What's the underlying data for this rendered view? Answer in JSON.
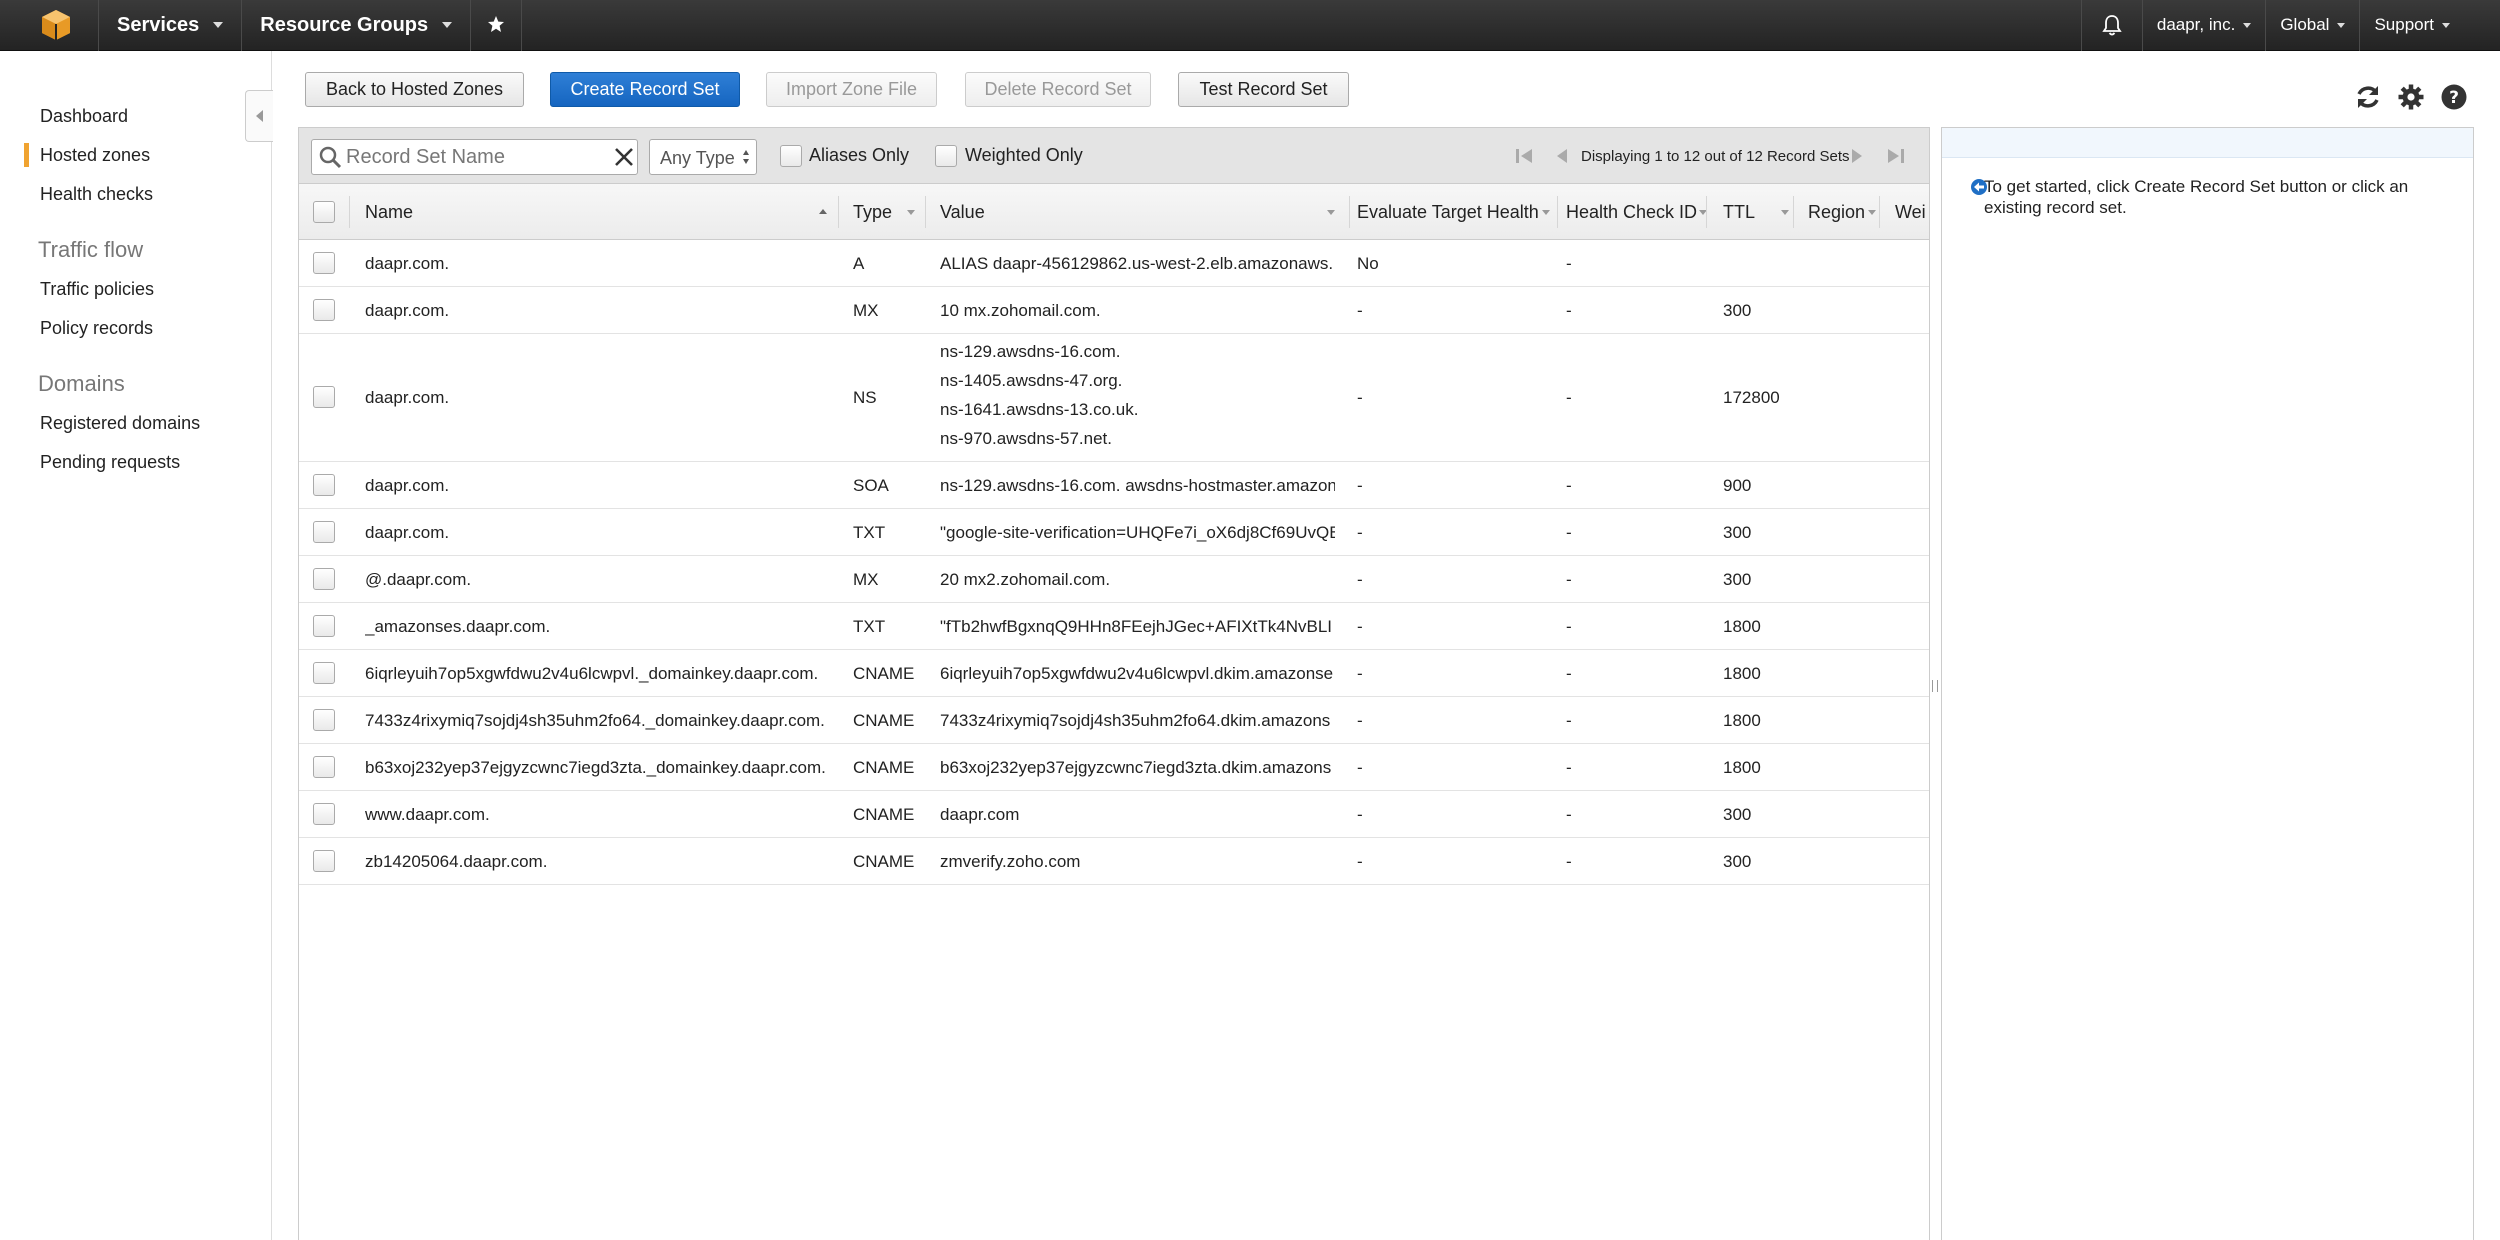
{
  "nav": {
    "services": "Services",
    "resource_groups": "Resource Groups",
    "account": "daapr, inc.",
    "region": "Global",
    "support": "Support"
  },
  "sidebar": {
    "items": [
      {
        "label": "Dashboard"
      },
      {
        "label": "Hosted zones"
      },
      {
        "label": "Health checks"
      }
    ],
    "traffic_heading": "Traffic flow",
    "traffic_items": [
      {
        "label": "Traffic policies"
      },
      {
        "label": "Policy records"
      }
    ],
    "domains_heading": "Domains",
    "domain_items": [
      {
        "label": "Registered domains"
      },
      {
        "label": "Pending requests"
      }
    ]
  },
  "toolbar": {
    "back": "Back to Hosted Zones",
    "create": "Create Record Set",
    "import": "Import Zone File",
    "delete": "Delete Record Set",
    "test": "Test Record Set"
  },
  "filter": {
    "search_placeholder": "Record Set Name",
    "type_select": "Any Type",
    "aliases_only": "Aliases Only",
    "weighted_only": "Weighted Only",
    "pager": "Displaying 1 to 12 out of 12 Record Sets"
  },
  "table": {
    "columns": [
      "Name",
      "Type",
      "Value",
      "Evaluate Target Health",
      "Health Check ID",
      "TTL",
      "Region",
      "Wei"
    ],
    "rows": [
      {
        "name": "daapr.com.",
        "type": "A",
        "value": [
          "ALIAS daapr-456129862.us-west-2.elb.amazonaws."
        ],
        "eth": "No",
        "hc": "-",
        "ttl": ""
      },
      {
        "name": "daapr.com.",
        "type": "MX",
        "value": [
          "10 mx.zohomail.com."
        ],
        "eth": "-",
        "hc": "-",
        "ttl": "300"
      },
      {
        "name": "daapr.com.",
        "type": "NS",
        "value": [
          "ns-129.awsdns-16.com.",
          "ns-1405.awsdns-47.org.",
          "ns-1641.awsdns-13.co.uk.",
          "ns-970.awsdns-57.net."
        ],
        "eth": "-",
        "hc": "-",
        "ttl": "172800"
      },
      {
        "name": "daapr.com.",
        "type": "SOA",
        "value": [
          "ns-129.awsdns-16.com. awsdns-hostmaster.amazon"
        ],
        "eth": "-",
        "hc": "-",
        "ttl": "900"
      },
      {
        "name": "daapr.com.",
        "type": "TXT",
        "value": [
          "\"google-site-verification=UHQFe7i_oX6dj8Cf69UvQB"
        ],
        "eth": "-",
        "hc": "-",
        "ttl": "300"
      },
      {
        "name": "@.daapr.com.",
        "type": "MX",
        "value": [
          "20 mx2.zohomail.com."
        ],
        "eth": "-",
        "hc": "-",
        "ttl": "300"
      },
      {
        "name": "_amazonses.daapr.com.",
        "type": "TXT",
        "value": [
          "\"fTb2hwfBgxnqQ9HHn8FEejhJGec+AFIXtTk4NvBLI"
        ],
        "eth": "-",
        "hc": "-",
        "ttl": "1800"
      },
      {
        "name": "6iqrleyuih7op5xgwfdwu2v4u6lcwpvl._domainkey.daapr.com.",
        "type": "CNAME",
        "value": [
          "6iqrleyuih7op5xgwfdwu2v4u6lcwpvl.dkim.amazonse"
        ],
        "eth": "-",
        "hc": "-",
        "ttl": "1800"
      },
      {
        "name": "7433z4rixymiq7sojdj4sh35uhm2fo64._domainkey.daapr.com.",
        "type": "CNAME",
        "value": [
          "7433z4rixymiq7sojdj4sh35uhm2fo64.dkim.amazons"
        ],
        "eth": "-",
        "hc": "-",
        "ttl": "1800"
      },
      {
        "name": "b63xoj232yep37ejgyzcwnc7iegd3zta._domainkey.daapr.com.",
        "type": "CNAME",
        "value": [
          "b63xoj232yep37ejgyzcwnc7iegd3zta.dkim.amazons"
        ],
        "eth": "-",
        "hc": "-",
        "ttl": "1800"
      },
      {
        "name": "www.daapr.com.",
        "type": "CNAME",
        "value": [
          "daapr.com"
        ],
        "eth": "-",
        "hc": "-",
        "ttl": "300"
      },
      {
        "name": "zb14205064.daapr.com.",
        "type": "CNAME",
        "value": [
          "zmverify.zoho.com"
        ],
        "eth": "-",
        "hc": "-",
        "ttl": "300"
      }
    ]
  },
  "info": {
    "text": "To get started, click Create Record Set button or click an existing record set."
  },
  "colors": {
    "accent": "#f0a330",
    "primary_button": "#1565c0",
    "nav_bg": "#232323"
  }
}
